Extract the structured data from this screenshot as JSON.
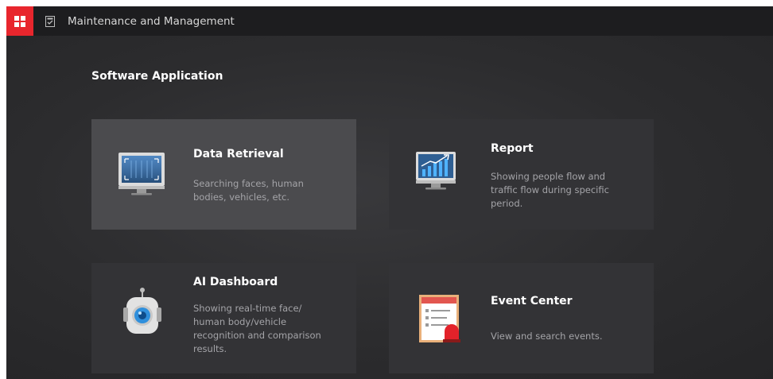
{
  "app": {
    "module_title": "Maintenance and Management"
  },
  "section": {
    "title": "Software Application"
  },
  "cards": [
    {
      "title": "Data Retrieval",
      "description": "Searching faces, human bodies, vehicles, etc.",
      "icon": "monitor-scan-icon",
      "selected": true
    },
    {
      "title": "Report",
      "description": "Showing people flow and traffic flow during specific period.",
      "icon": "monitor-chart-icon",
      "selected": false
    },
    {
      "title": "AI Dashboard",
      "description": "Showing real-time face/ human body/vehicle recognition and comparison results.",
      "icon": "robot-camera-icon",
      "selected": false
    },
    {
      "title": "Event Center",
      "description": "View and search events.",
      "icon": "event-list-alarm-icon",
      "selected": false
    }
  ],
  "colors": {
    "accent": "#e8262d",
    "topbar": "#1d1d1f",
    "background": "#2b2b2d",
    "card": "#333336",
    "card_selected": "#4b4b4e",
    "icon_blue": "#2f8fdc"
  }
}
